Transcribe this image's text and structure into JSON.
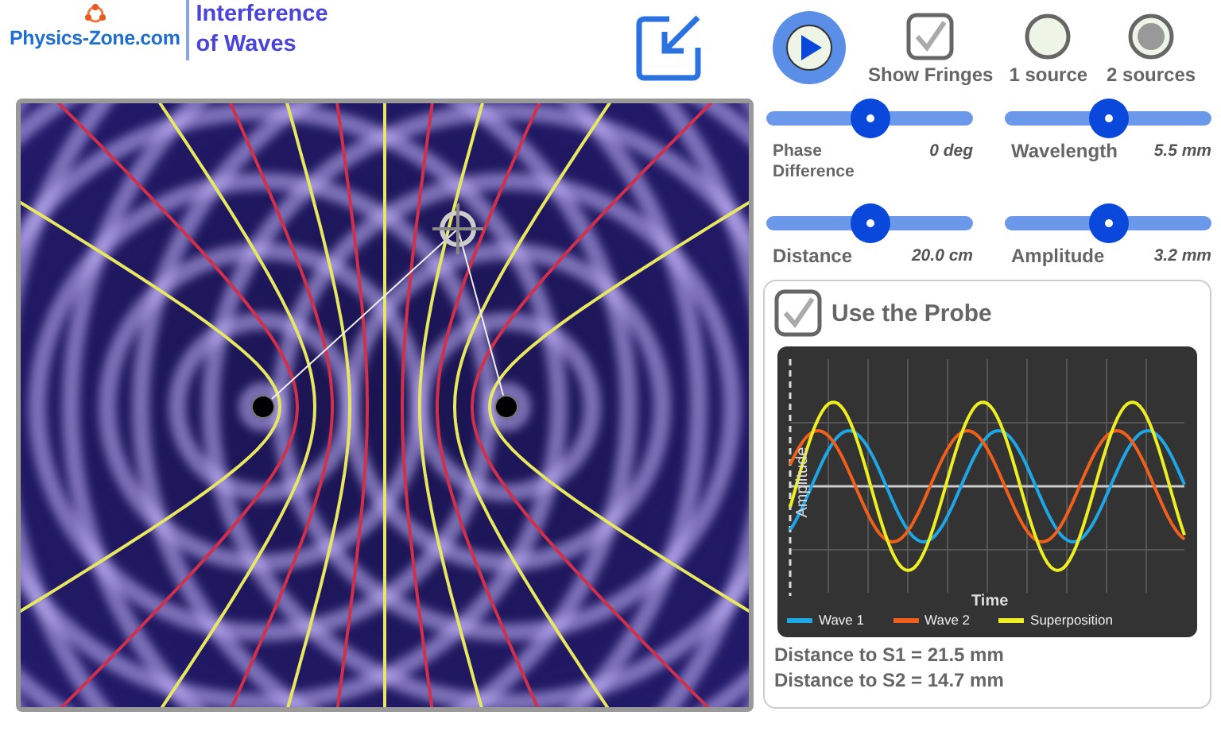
{
  "header": {
    "logo_text": "Physics-Zone.com",
    "title_lines": [
      "Interference",
      "of Waves"
    ]
  },
  "show_fringes": {
    "label": "Show Fringes",
    "checked": true
  },
  "source_options": [
    {
      "label": "1 source",
      "selected": false
    },
    {
      "label": "2 sources",
      "selected": true
    }
  ],
  "sliders": [
    {
      "label": "Phase Difference",
      "reading": "0 deg",
      "level": 0.5
    },
    {
      "label": "Wavelength",
      "reading": "5.5 mm",
      "level": 0.5
    },
    {
      "label": "Distance",
      "reading": "20.0 cm",
      "level": 0.5
    },
    {
      "label": "Amplitude",
      "reading": "3.2 mm",
      "level": 0.5
    }
  ],
  "probe": {
    "label": "Use the Probe",
    "checked": true,
    "graph": {
      "ylabel": "Amplitude",
      "xlabel": "Time",
      "legend": [
        {
          "name": "Wave 1",
          "color": "#1ea7e6"
        },
        {
          "name": "Wave 2",
          "color": "#f0601a"
        },
        {
          "name": "Superposition",
          "color": "#eeee22"
        }
      ]
    },
    "readouts": [
      "Distance to S1 = 21.5 mm",
      "Distance to S2 = 14.7 mm"
    ]
  }
}
